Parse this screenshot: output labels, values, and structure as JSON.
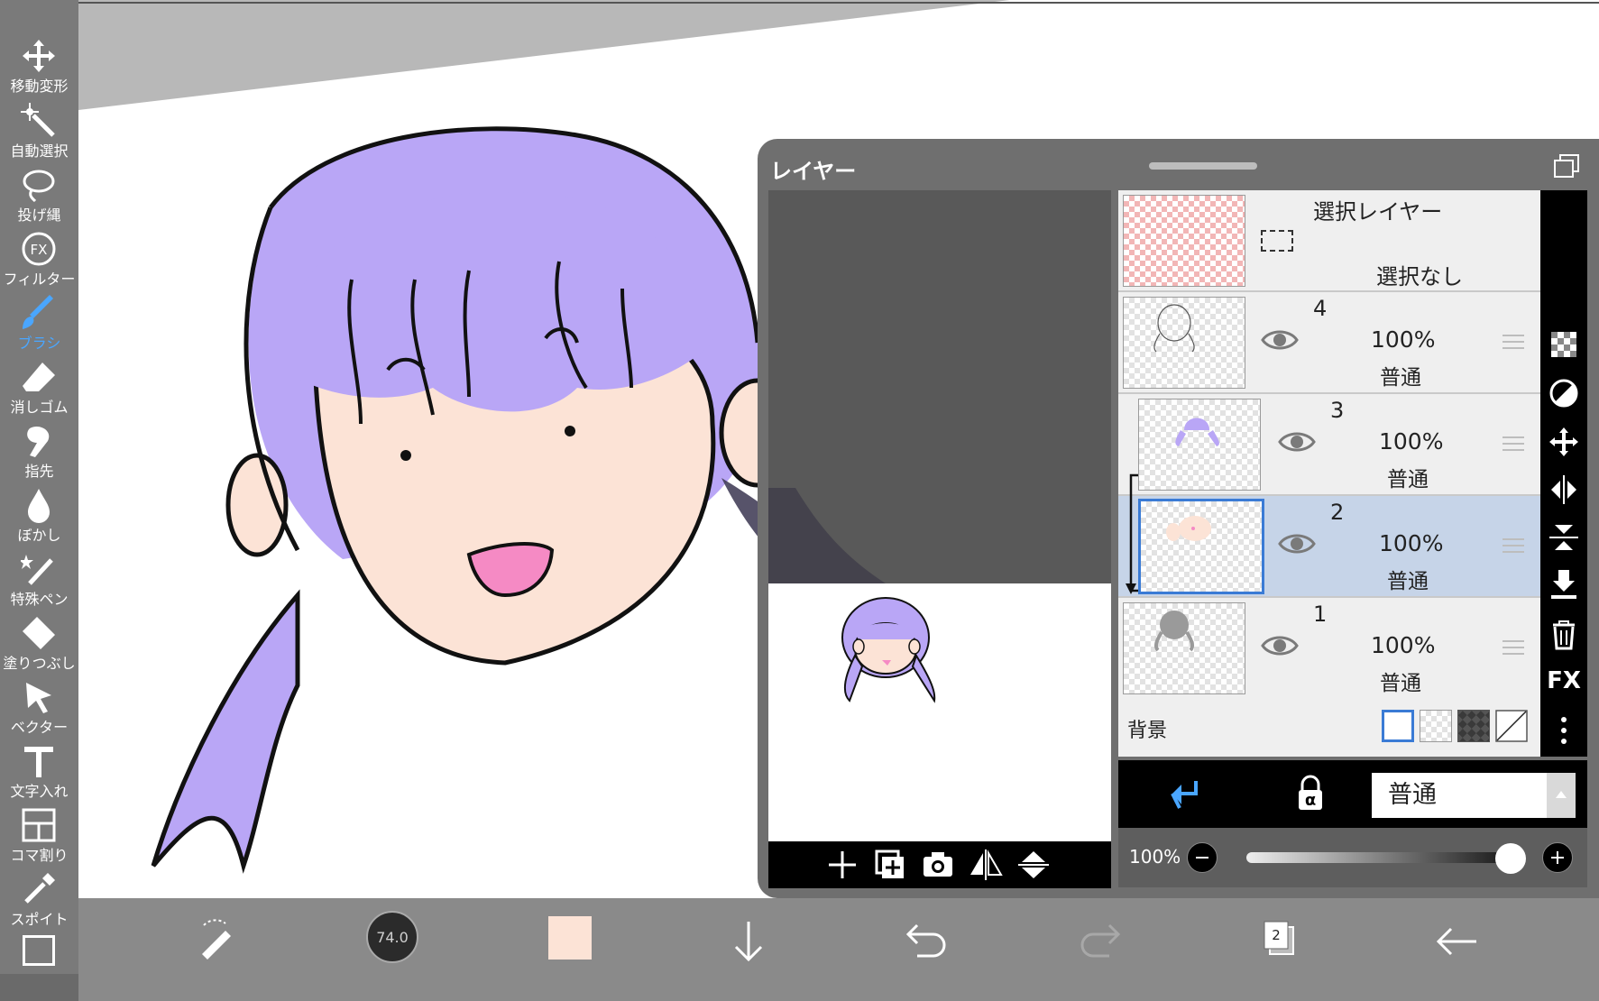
{
  "toolbar": {
    "tools": [
      {
        "label": "移動変形",
        "icon": "move-icon"
      },
      {
        "label": "自動選択",
        "icon": "magic-wand-icon"
      },
      {
        "label": "投げ縄",
        "icon": "lasso-icon"
      },
      {
        "label": "フィルター",
        "icon": "fx-filter-icon"
      },
      {
        "label": "ブラシ",
        "icon": "brush-icon",
        "active": true
      },
      {
        "label": "消しゴム",
        "icon": "eraser-icon"
      },
      {
        "label": "指先",
        "icon": "finger-smudge-icon"
      },
      {
        "label": "ぼかし",
        "icon": "blur-drop-icon"
      },
      {
        "label": "特殊ペン",
        "icon": "special-pen-icon"
      },
      {
        "label": "塗りつぶし",
        "icon": "fill-bucket-icon"
      },
      {
        "label": "ベクター",
        "icon": "vector-arrow-icon"
      },
      {
        "label": "文字入れ",
        "icon": "text-icon"
      },
      {
        "label": "コマ割り",
        "icon": "frame-divider-icon"
      },
      {
        "label": "スポイト",
        "icon": "eyedropper-icon"
      }
    ],
    "active_color": "#4aa6ff"
  },
  "bottom_bar": {
    "brush_size": "74.0",
    "current_color": "#fce3d6",
    "layer_count": "2"
  },
  "layer_panel": {
    "title": "レイヤー",
    "selection_layer": {
      "name": "選択レイヤー",
      "status": "選択なし"
    },
    "layers": [
      {
        "number": "4",
        "opacity": "100%",
        "mode": "普通"
      },
      {
        "number": "3",
        "opacity": "100%",
        "mode": "普通"
      },
      {
        "number": "2",
        "opacity": "100%",
        "mode": "普通",
        "selected": true
      },
      {
        "number": "1",
        "opacity": "100%",
        "mode": "普通"
      }
    ],
    "background_label": "背景",
    "blend_mode": "普通",
    "opacity_label": "100%",
    "side_fx_label": "FX",
    "alpha_lock_label": "α"
  },
  "colors": {
    "hair": "#b9a6f6",
    "skin": "#fce3d6",
    "mouth": "#f58ac4",
    "selected_row": "#c6d4e8"
  }
}
